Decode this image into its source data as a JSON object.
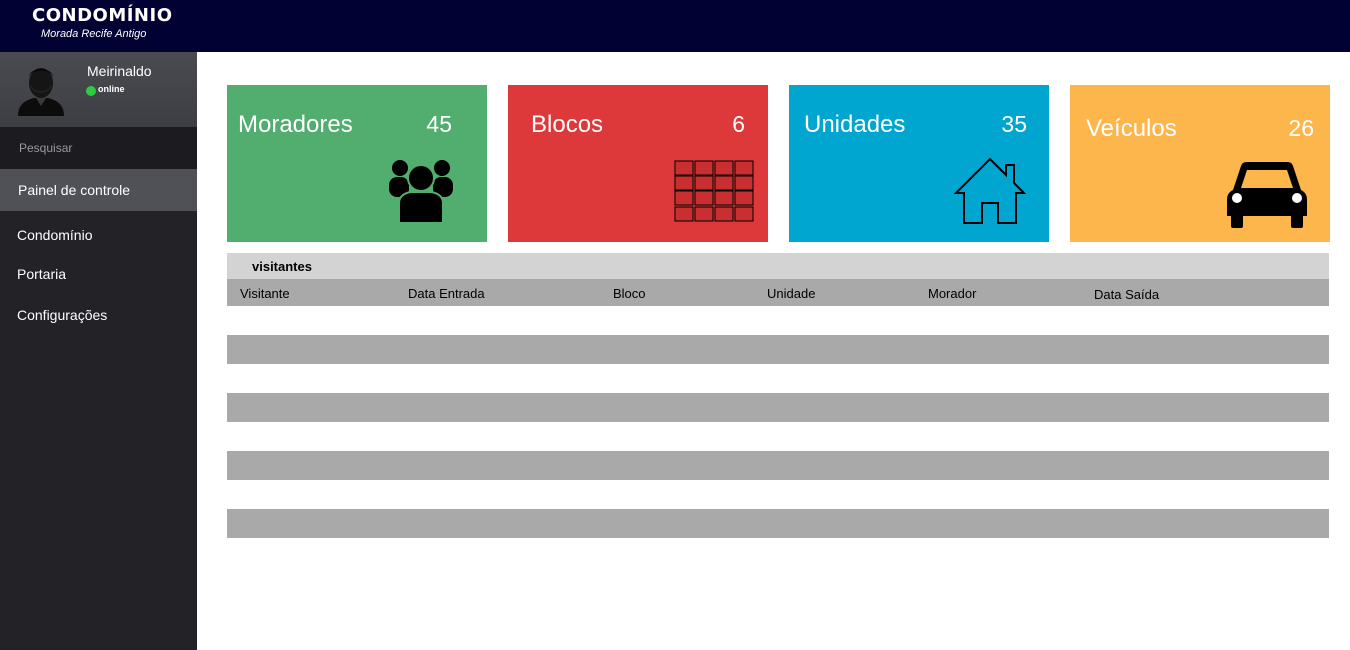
{
  "header": {
    "title": "CONDOMÍNIO",
    "subtitle": "Morada Recife Antigo"
  },
  "user": {
    "name": "Meirinaldo",
    "status": "online",
    "status_color": "#2ecc40"
  },
  "search": {
    "placeholder": "Pesquisar"
  },
  "nav": {
    "items": [
      {
        "label": "Painel de controle",
        "active": true
      },
      {
        "label": "Condomínio"
      },
      {
        "label": "Portaria"
      },
      {
        "label": "Configurações"
      }
    ]
  },
  "cards": [
    {
      "label": "Moradores",
      "count": "45",
      "color": "#52ae6e",
      "icon": "people-icon"
    },
    {
      "label": "Blocos",
      "count": "6",
      "color": "#dd383a",
      "icon": "brick-wall-icon"
    },
    {
      "label": "Unidades",
      "count": "35",
      "color": "#00a6cf",
      "icon": "house-icon"
    },
    {
      "label": "Veículos",
      "count": "26",
      "color": "#fcb64c",
      "icon": "car-icon"
    }
  ],
  "table": {
    "title": "visitantes",
    "columns": [
      "Visitante",
      "Data Entrada",
      "Bloco",
      "Unidade",
      "Morador",
      "Data Saída"
    ],
    "rows": [
      [],
      [],
      [],
      [],
      [],
      [],
      [],
      []
    ]
  },
  "colors": {
    "topbar": "#010133",
    "sidebar": "#222227",
    "row_alt": "#a9a9a9"
  }
}
